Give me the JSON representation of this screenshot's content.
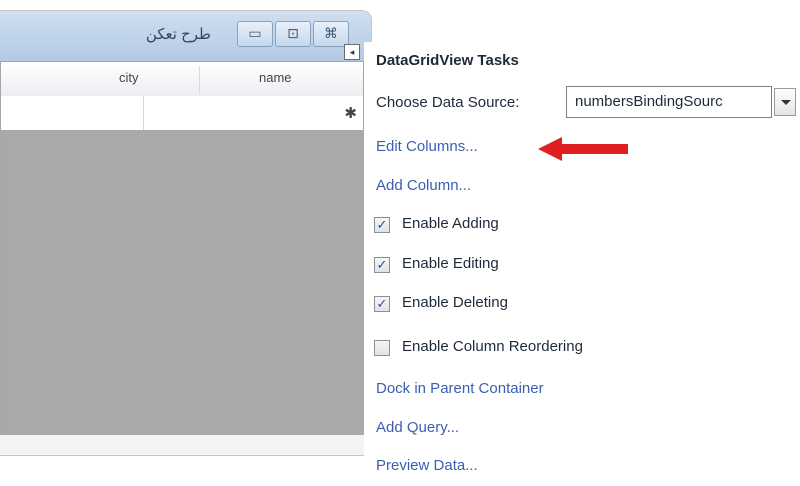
{
  "form": {
    "title": "طرح تعكن",
    "controls": {
      "minimize_glyph": "▭",
      "maximize_glyph": "⊡",
      "close_glyph": "⌘"
    }
  },
  "grid": {
    "columns": [
      "city",
      "name"
    ],
    "new_row_marker": "✱"
  },
  "smart_tag": {
    "glyph": "◂",
    "title": "DataGridView Tasks",
    "data_source": {
      "label": "Choose Data Source:",
      "value": "numbersBindingSourc"
    },
    "links": {
      "edit_columns": "Edit Columns...",
      "add_column": "Add Column...",
      "dock": "Dock in Parent Container",
      "add_query": "Add Query...",
      "preview_data": "Preview Data..."
    },
    "options": [
      {
        "label": "Enable Adding",
        "checked": true
      },
      {
        "label": "Enable Editing",
        "checked": true
      },
      {
        "label": "Enable Deleting",
        "checked": true
      },
      {
        "label": "Enable Column Reordering",
        "checked": false
      }
    ]
  },
  "colors": {
    "link": "#3a5fb0",
    "grid_background": "#a9a9a9",
    "arrow": "#e02020"
  },
  "icons": [
    "minimize-icon",
    "maximize-icon",
    "close-icon",
    "new-row-icon",
    "smart-tag-icon",
    "dropdown-arrow-icon",
    "checkmark-icon",
    "red-arrow-icon"
  ]
}
